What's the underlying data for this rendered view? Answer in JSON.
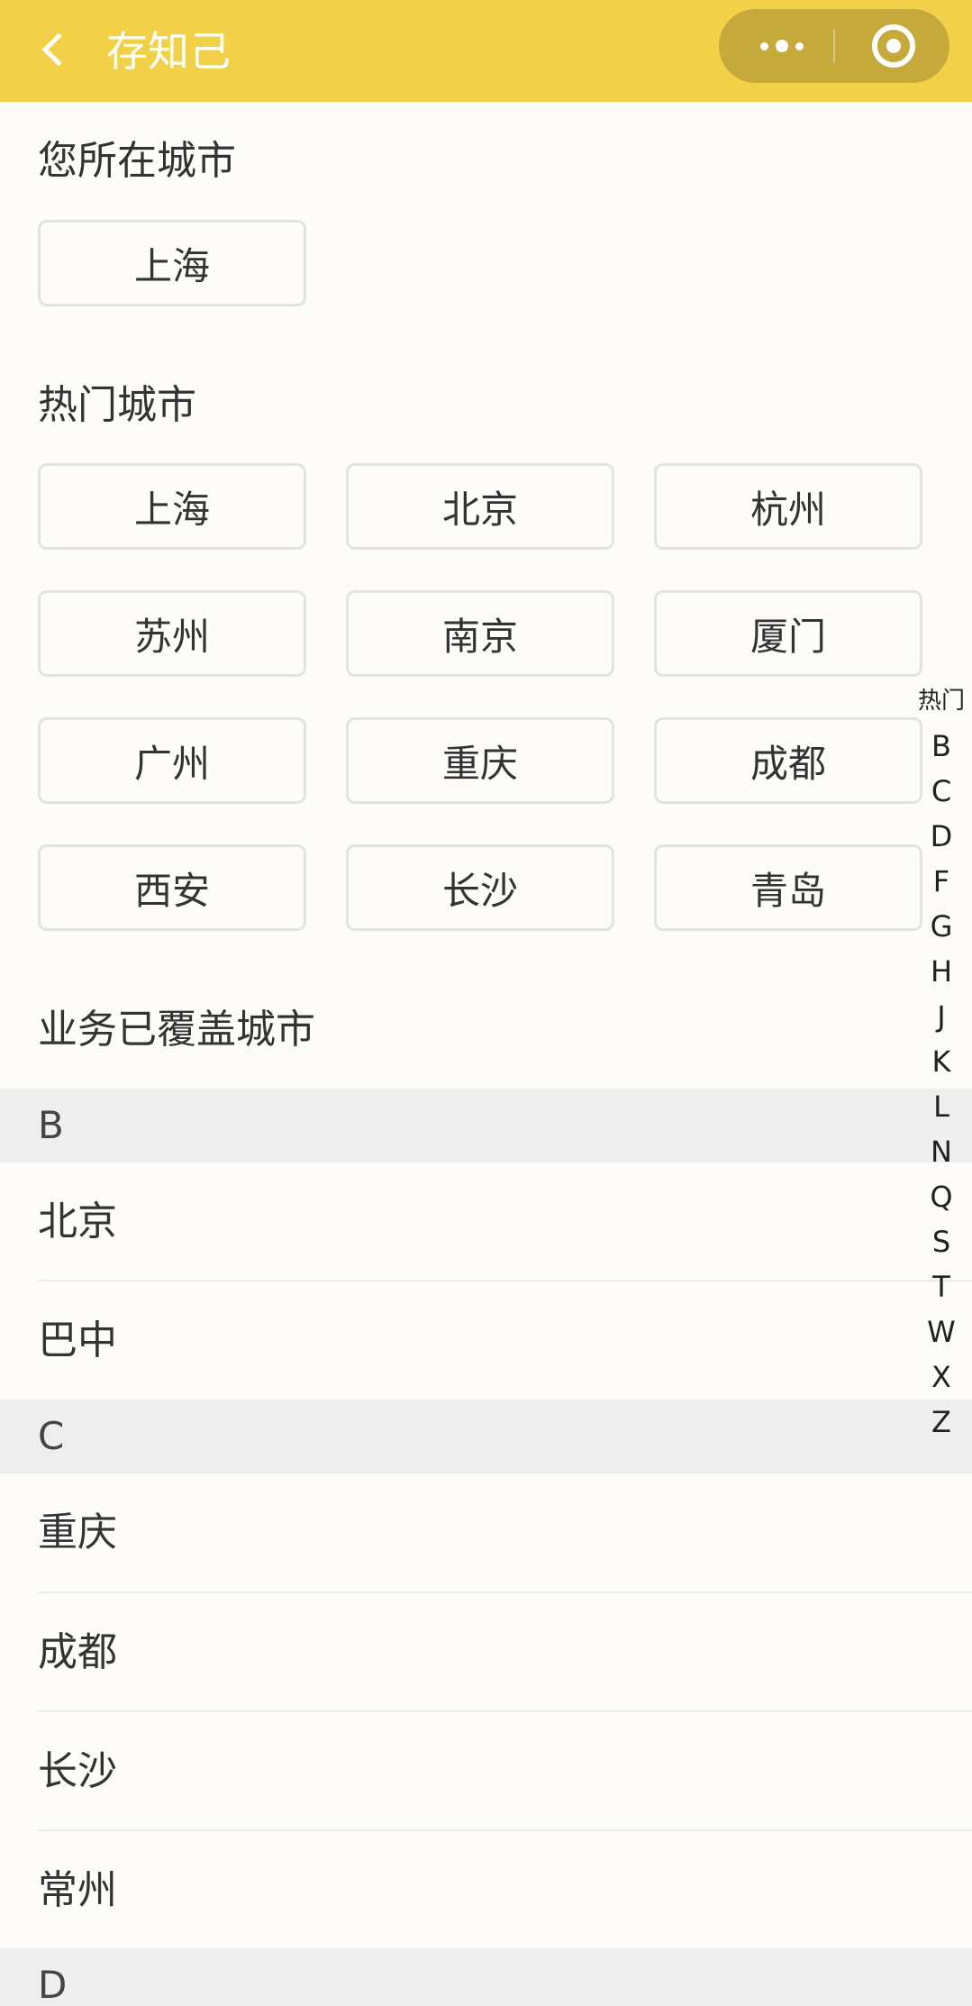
{
  "header": {
    "title": "存知己"
  },
  "current_city": {
    "title": "您所在城市",
    "city": "上海"
  },
  "hot_cities": {
    "title": "热门城市",
    "cities": [
      "上海",
      "北京",
      "杭州",
      "苏州",
      "南京",
      "厦门",
      "广州",
      "重庆",
      "成都",
      "西安",
      "长沙",
      "青岛"
    ]
  },
  "covered": {
    "title": "业务已覆盖城市",
    "groups": [
      {
        "letter": "B",
        "cities": [
          "北京",
          "巴中"
        ]
      },
      {
        "letter": "C",
        "cities": [
          "重庆",
          "成都",
          "长沙",
          "常州"
        ]
      },
      {
        "letter": "D",
        "cities": []
      }
    ]
  },
  "index_bar": [
    "热门",
    "B",
    "C",
    "D",
    "F",
    "G",
    "H",
    "J",
    "K",
    "L",
    "N",
    "Q",
    "S",
    "T",
    "W",
    "X",
    "Z"
  ],
  "colors": {
    "navbar": "#f2d048",
    "capsule": "#c5a93b",
    "group_header_bg": "#eeeeee"
  },
  "icons": {
    "back": "chevron-left-icon",
    "more": "more-dots-icon",
    "close": "target-circle-icon"
  }
}
